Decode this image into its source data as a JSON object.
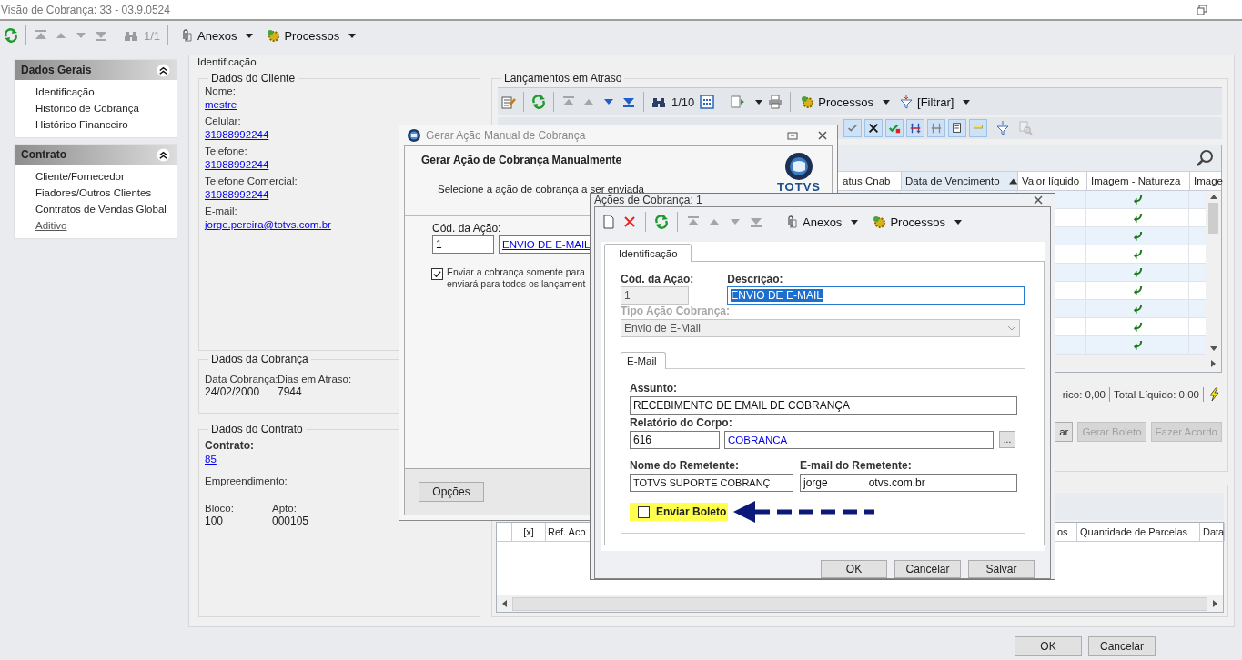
{
  "window": {
    "title": "Visão de Cobrança: 33 - 03.9.0524"
  },
  "toolbar": {
    "counter": "1/1",
    "menus": [
      "Anexos",
      "Processos"
    ]
  },
  "sidebar": [
    {
      "title": "Dados Gerais",
      "expanded": true,
      "items": [
        {
          "label": "Identificação",
          "kind": "item"
        },
        {
          "label": "Histórico de Cobrança",
          "kind": "item"
        },
        {
          "label": "Histórico Financeiro",
          "kind": "item"
        }
      ]
    },
    {
      "title": "Contrato",
      "expanded": true,
      "items": [
        {
          "label": "Cliente/Fornecedor",
          "kind": "item"
        },
        {
          "label": "Fiadores/Outros Clientes",
          "kind": "item"
        },
        {
          "label": "Contratos de Vendas Global",
          "kind": "item"
        },
        {
          "label": "Aditivo",
          "kind": "link"
        }
      ]
    }
  ],
  "identificacao": {
    "title": "Identificação",
    "cliente": {
      "title": "Dados do Cliente",
      "fields": [
        {
          "label": "Nome:",
          "value": "mestre"
        },
        {
          "label": "Celular:",
          "value": "31988992244"
        },
        {
          "label": "Telefone:",
          "value": "31988992244"
        },
        {
          "label": "Telefone Comercial:",
          "value": "31988992244"
        },
        {
          "label": "E-mail:",
          "value": "jorge.pereira@totvs.com.br"
        }
      ]
    },
    "cobranca": {
      "title": "Dados da Cobrança",
      "fields": [
        {
          "label": "Data Cobrança:",
          "value": "24/02/2000"
        },
        {
          "label": "Dias em Atraso:",
          "value": "7944"
        }
      ]
    },
    "contrato": {
      "title": "Dados do Contrato",
      "contrato_label": "Contrato:",
      "contrato_value": "85",
      "empreendimento_label": "Empreendimento:",
      "fields": [
        {
          "label": "Bloco:",
          "value": "100"
        },
        {
          "label": "Apto:",
          "value": "000105"
        }
      ]
    }
  },
  "lancamentos": {
    "title": "Lançamentos em Atraso",
    "counter": "1/10",
    "menus": [
      "Processos",
      "[Filtrar]"
    ],
    "columns": [
      {
        "label": "atus Cnab",
        "sorted": false
      },
      {
        "label": "Data de Vencimento",
        "sorted": true
      },
      {
        "label": "Valor líquido",
        "sorted": false
      },
      {
        "label": "Imagem - Natureza",
        "sorted": false
      },
      {
        "label": "Image",
        "sorted": false
      }
    ],
    "totals": [
      "rico: 0,00",
      "Total Líquido: 0,00"
    ],
    "buttons": [
      {
        "label": "ar",
        "disabled": false
      },
      {
        "label": "Gerar Boleto",
        "disabled": true
      },
      {
        "label": "Fazer Acordo",
        "disabled": true
      }
    ]
  },
  "acordos": {
    "columns_left": [
      "[x]",
      "Ref. Aco"
    ],
    "columns_right": [
      "os",
      "Quantidade de Parcelas",
      "Data"
    ]
  },
  "footer_buttons": [
    "OK",
    "Cancelar"
  ],
  "gerar_dialog": {
    "title": "Gerar Ação Manual de Cobrança",
    "heading": "Gerar Ação de Cobrança Manualmente",
    "subtitle": "Selecione a ação de cobrança a ser enviada",
    "logo": "TOTVS",
    "cod_label": "Cód. da Ação:",
    "cod_value": "1",
    "acao_link": "ENVIO DE E-MAIL",
    "option": {
      "checked": true,
      "lines": [
        "Enviar a cobrança somente para",
        "enviará para todos os lançament"
      ]
    },
    "options_button": "Opções"
  },
  "acoes_dialog": {
    "title": "Ações de Cobrança: 1",
    "menus": [
      "Anexos",
      "Processos"
    ],
    "tabs": [
      {
        "label": "Identificação",
        "selected": true
      }
    ],
    "cod": {
      "label": "Cód. da Ação:",
      "value": "1",
      "disabled": true
    },
    "descricao": {
      "label": "Descrição:",
      "value": "ENVIO DE E-MAIL",
      "selected": true
    },
    "tipo": {
      "label": "Tipo Ação Cobrança:",
      "value": "Envio de E-Mail",
      "disabled": true
    },
    "inner_tabs": [
      {
        "label": "E-Mail",
        "selected": true
      }
    ],
    "assunto": {
      "label": "Assunto:",
      "value": "RECEBIMENTO DE EMAIL DE COBRANÇA"
    },
    "relatorio": {
      "label": "Relatório do Corpo:",
      "code": "616",
      "link": "COBRANCA",
      "browse": "..."
    },
    "remetente": {
      "label": "Nome do Remetente:",
      "value": "TOTVS SUPORTE COBRANÇ"
    },
    "email": {
      "label": "E-mail do Remetente:",
      "value_parts": [
        "jorge",
        "otvs.com.br"
      ]
    },
    "enviar_boleto": {
      "label": "Enviar Boleto",
      "checked": false
    },
    "buttons": [
      "OK",
      "Cancelar",
      "Salvar"
    ]
  }
}
